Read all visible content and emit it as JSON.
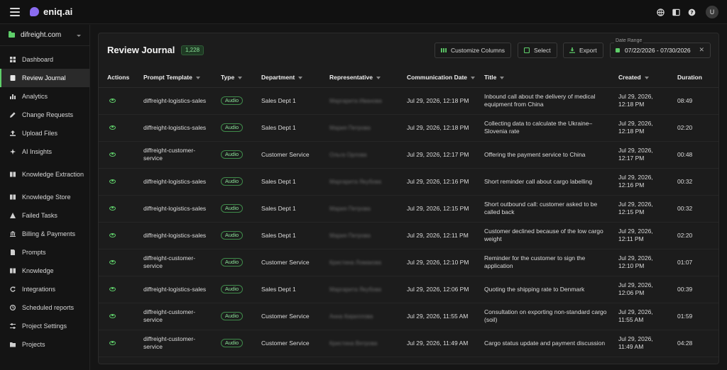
{
  "app": {
    "name": "eniq.ai"
  },
  "project": {
    "name": "difreight.com"
  },
  "top_icons": [
    "globe-icon",
    "sidebar-toggle-icon",
    "help-icon"
  ],
  "user": {
    "initial": "U"
  },
  "sidebar": {
    "items": [
      {
        "label": "Dashboard",
        "icon": "grid-icon"
      },
      {
        "label": "Review Journal",
        "icon": "journal-icon",
        "active": true
      },
      {
        "label": "Analytics",
        "icon": "bar-chart-icon"
      },
      {
        "label": "Change Requests",
        "icon": "pencil-icon"
      },
      {
        "label": "Upload Files",
        "icon": "upload-icon"
      },
      {
        "label": "AI Insights",
        "icon": "sparkle-icon"
      },
      {
        "label": "Knowledge Extraction",
        "icon": "book-icon"
      },
      {
        "label": "Knowledge Store",
        "icon": "book-icon"
      },
      {
        "label": "Failed Tasks",
        "icon": "warning-icon"
      },
      {
        "label": "Billing & Payments",
        "icon": "bank-icon"
      },
      {
        "label": "Prompts",
        "icon": "document-icon"
      },
      {
        "label": "Knowledge",
        "icon": "book-icon"
      },
      {
        "label": "Integrations",
        "icon": "refresh-icon"
      },
      {
        "label": "Scheduled reports",
        "icon": "clock-icon"
      },
      {
        "label": "Project Settings",
        "icon": "sliders-icon"
      },
      {
        "label": "Projects",
        "icon": "folder-icon"
      }
    ]
  },
  "main": {
    "title": "Review Journal",
    "count": "1,228",
    "buttons": {
      "customize": "Customize Columns",
      "select": "Select",
      "export": "Export"
    },
    "date_range": {
      "legend": "Date Range",
      "value": "07/22/2026 - 07/30/2026"
    }
  },
  "table": {
    "columns": [
      "Actions",
      "Prompt Template",
      "Type",
      "Department",
      "Representative",
      "Communication Date",
      "Title",
      "Created",
      "Duration"
    ],
    "rows": [
      {
        "template": "diffreight-logistics-sales",
        "type": "Audio",
        "department": "Sales Dept 1",
        "rep": "Маргарита Иванова",
        "comm_date": "Jul 29, 2026, 12:18 PM",
        "title": "Inbound call about the delivery of medical equipment from China",
        "created": "Jul 29, 2026, 12:18 PM",
        "duration": "08:49"
      },
      {
        "template": "diffreight-logistics-sales",
        "type": "Audio",
        "department": "Sales Dept 1",
        "rep": "Мария Петрова",
        "comm_date": "Jul 29, 2026, 12:18 PM",
        "title": "Collecting data to calculate the Ukraine–Slovenia rate",
        "created": "Jul 29, 2026, 12:18 PM",
        "duration": "02:20"
      },
      {
        "template": "diffreight-customer-service",
        "type": "Audio",
        "department": "Customer Service",
        "rep": "Ольга Орлова",
        "comm_date": "Jul 29, 2026, 12:17 PM",
        "title": "Offering the payment service to China",
        "created": "Jul 29, 2026, 12:17 PM",
        "duration": "00:48"
      },
      {
        "template": "diffreight-logistics-sales",
        "type": "Audio",
        "department": "Sales Dept 1",
        "rep": "Маргарита Якубова",
        "comm_date": "Jul 29, 2026, 12:16 PM",
        "title": "Short reminder call about cargo labelling",
        "created": "Jul 29, 2026, 12:16 PM",
        "duration": "00:32"
      },
      {
        "template": "diffreight-logistics-sales",
        "type": "Audio",
        "department": "Sales Dept 1",
        "rep": "Мария Петрова",
        "comm_date": "Jul 29, 2026, 12:15 PM",
        "title": "Short outbound call: customer asked to be called back",
        "created": "Jul 29, 2026, 12:15 PM",
        "duration": "00:32"
      },
      {
        "template": "diffreight-logistics-sales",
        "type": "Audio",
        "department": "Sales Dept 1",
        "rep": "Мария Петрова",
        "comm_date": "Jul 29, 2026, 12:11 PM",
        "title": "Customer declined because of the low cargo weight",
        "created": "Jul 29, 2026, 12:11 PM",
        "duration": "02:20"
      },
      {
        "template": "diffreight-customer-service",
        "type": "Audio",
        "department": "Customer Service",
        "rep": "Кристина Ломакова",
        "comm_date": "Jul 29, 2026, 12:10 PM",
        "title": "Reminder for the customer to sign the application",
        "created": "Jul 29, 2026, 12:10 PM",
        "duration": "01:07"
      },
      {
        "template": "diffreight-logistics-sales",
        "type": "Audio",
        "department": "Sales Dept 1",
        "rep": "Маргарита Якубова",
        "comm_date": "Jul 29, 2026, 12:06 PM",
        "title": "Quoting the shipping rate to Denmark",
        "created": "Jul 29, 2026, 12:06 PM",
        "duration": "00:39"
      },
      {
        "template": "diffreight-customer-service",
        "type": "Audio",
        "department": "Customer Service",
        "rep": "Анна Кириллова",
        "comm_date": "Jul 29, 2026, 11:55 AM",
        "title": "Consultation on exporting non-standard cargo (soil)",
        "created": "Jul 29, 2026, 11:55 AM",
        "duration": "01:59"
      },
      {
        "template": "diffreight-customer-service",
        "type": "Audio",
        "department": "Customer Service",
        "rep": "Кристина Ветрова",
        "comm_date": "Jul 29, 2026, 11:49 AM",
        "title": "Cargo status update and payment discussion",
        "created": "Jul 29, 2026, 11:49 AM",
        "duration": "04:28"
      }
    ]
  },
  "colors": {
    "accent": "#5fcf6a",
    "background": "#151515",
    "card": "#1c1c1c"
  }
}
